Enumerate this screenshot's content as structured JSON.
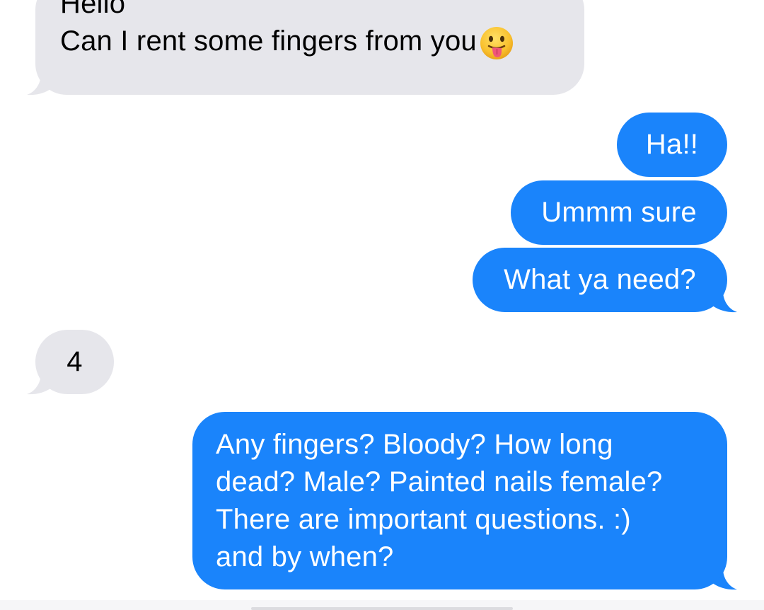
{
  "messages": [
    {
      "id": "m1",
      "direction": "incoming",
      "lines": [
        "Hello",
        "Can I rent some fingers from you"
      ],
      "emoji": "face-with-tongue"
    },
    {
      "id": "m2",
      "direction": "outgoing",
      "lines": [
        "Ha!!"
      ]
    },
    {
      "id": "m3",
      "direction": "outgoing",
      "lines": [
        "Ummm sure"
      ]
    },
    {
      "id": "m4",
      "direction": "outgoing",
      "lines": [
        "What ya need?"
      ]
    },
    {
      "id": "m5",
      "direction": "incoming",
      "lines": [
        "4"
      ]
    },
    {
      "id": "m6",
      "direction": "outgoing",
      "lines": [
        "Any fingers? Bloody? How long",
        "dead? Male? Painted nails female?",
        "There are important questions. :)",
        "and by when?"
      ]
    }
  ],
  "colors": {
    "incoming_bubble": "#e6e6eb",
    "outgoing_bubble": "#1a84fb",
    "incoming_text": "#000000",
    "outgoing_text": "#ffffff"
  }
}
